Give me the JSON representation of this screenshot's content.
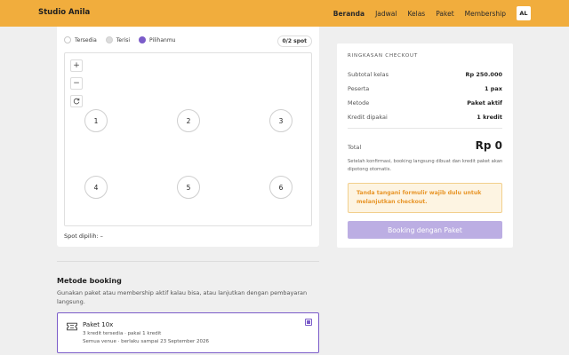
{
  "header": {
    "brand": "Studio Anila",
    "nav": [
      "Beranda",
      "Jadwal",
      "Kelas",
      "Paket",
      "Membership"
    ],
    "active_nav": "Beranda",
    "avatar_initials": "AL",
    "background_color": "#f1ad3d"
  },
  "seat_map": {
    "legend": {
      "available": "Tersedia",
      "taken": "Terisi",
      "mine": "Pilihanmu"
    },
    "spot_count": "0/2 spot",
    "controls": {
      "zoom_in": "+",
      "zoom_out": "−"
    },
    "spots": [
      "1",
      "2",
      "3",
      "4",
      "5",
      "6"
    ],
    "selected_label": "Spot dipilih:",
    "selected_value": "–"
  },
  "booking_method": {
    "title": "Metode booking",
    "description": "Gunakan paket atau membership aktif kalau bisa, atau lanjutkan dengan pembayaran langsung.",
    "package": {
      "name": "Paket 10x",
      "meta": "3 kredit tersedia · pakai 1 kredit",
      "meta2": "Semua venue · berlaku sampai 23 September 2026",
      "selected": true
    }
  },
  "summary": {
    "title": "RINGKASAN CHECKOUT",
    "rows": [
      {
        "label": "Subtotal kelas",
        "value": "Rp 250.000"
      },
      {
        "label": "Peserta",
        "value": "1 pax"
      },
      {
        "label": "Metode",
        "value": "Paket aktif"
      },
      {
        "label": "Kredit dipakai",
        "value": "1 kredit"
      }
    ],
    "total_label": "Total",
    "total_value": "Rp 0",
    "note": "Setelah konfirmasi, booking langsung dibuat dan kredit paket akan dipotong otomatis.",
    "warning": "Tanda tangani formulir wajib dulu untuk melanjutkan checkout.",
    "button": "Booking dengan Paket"
  },
  "colors": {
    "accent": "#7b5cc9",
    "warning_text": "#e8962a",
    "button_disabled": "#bcaee3"
  }
}
